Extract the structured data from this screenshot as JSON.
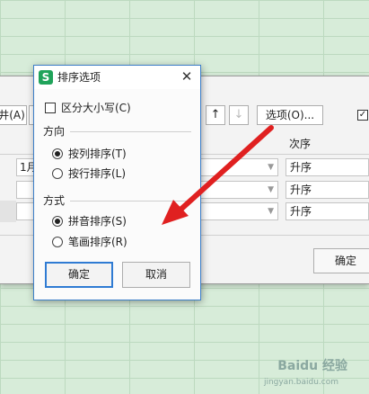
{
  "background_dialog": {
    "left_button_label": "井(A)",
    "options_button_label": "选项(O)...",
    "up_arrow": "↑",
    "down_arrow": "↓",
    "order_header": "次序",
    "row1_key": "1月",
    "orders": [
      "升序",
      "升序",
      "升序"
    ],
    "ok_label": "确定"
  },
  "options_dialog": {
    "title": "排序选项",
    "app_icon_letter": "S",
    "case_sensitive_label": "区分大小写(C)",
    "direction_group": "方向",
    "direction_options": [
      {
        "label": "按列排序(T)",
        "selected": true
      },
      {
        "label": "按行排序(L)",
        "selected": false
      }
    ],
    "method_group": "方式",
    "method_options": [
      {
        "label": "拼音排序(S)",
        "selected": true
      },
      {
        "label": "笔画排序(R)",
        "selected": false
      }
    ],
    "ok_label": "确定",
    "cancel_label": "取消"
  },
  "annotation": {
    "arrow_color": "#e02020"
  },
  "watermark": {
    "brand": "Baidu 经验",
    "sub": "jingyan.baidu.com"
  }
}
